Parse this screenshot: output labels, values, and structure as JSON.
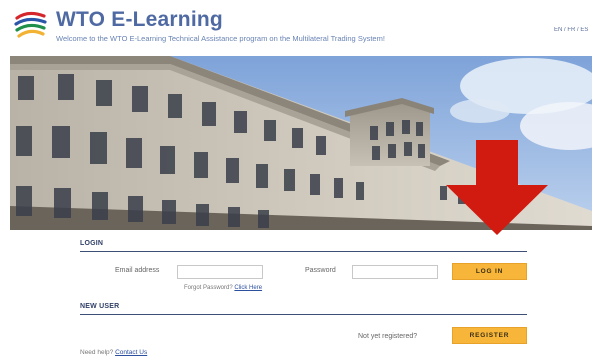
{
  "header": {
    "brand": "WTO E-Learning",
    "tagline": "Welcome to the WTO E-Learning Technical Assistance program on the Multilateral Trading System!",
    "languages": "EN / FR / ES"
  },
  "banner": {
    "icon": "wto-building-photo"
  },
  "annotation": {
    "icon": "red-down-arrow",
    "color": "#d11a10"
  },
  "login": {
    "title": "LOGIN",
    "email_label": "Email address",
    "email_value": "",
    "password_label": "Password",
    "password_value": "",
    "login_button": "LOG IN",
    "forgot_text": "Forgot Password?",
    "forgot_link": "Click Here"
  },
  "new_user": {
    "title": "NEW USER",
    "prompt": "Not yet registered?",
    "register_button": "REGISTER"
  },
  "help": {
    "text": "Need help?",
    "link": "Contact Us"
  },
  "colors": {
    "brand": "#4f6aa3",
    "button": "#f7b53a",
    "section_rule": "#3e4f77"
  }
}
